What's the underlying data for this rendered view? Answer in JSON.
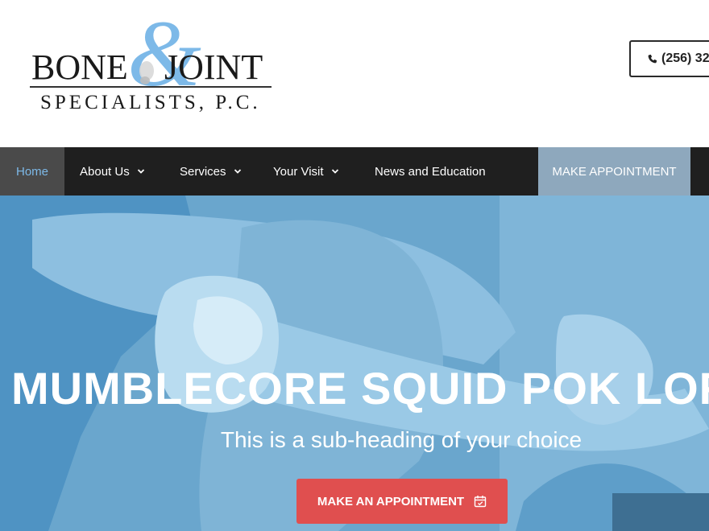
{
  "logo": {
    "word_left": "BONE",
    "word_right": "JOINT",
    "subtitle": "SPECIALISTS, P.C.",
    "ampersand_color": "#7db9e8"
  },
  "header": {
    "phone": "(256) 32",
    "phone_icon": "phone-icon"
  },
  "nav": {
    "items": [
      {
        "label": "Home",
        "active": true
      },
      {
        "label": "About Us",
        "has_dropdown": true
      },
      {
        "label": "Services",
        "has_dropdown": true
      },
      {
        "label": "Your Visit",
        "has_dropdown": true
      },
      {
        "label": "News and Education",
        "has_dropdown": false
      }
    ],
    "cta": "MAKE APPOINTMENT"
  },
  "hero": {
    "title": "MUMBLECORE SQUID POK LOR",
    "subheading": "This is a sub-heading of your choice",
    "button_label": "MAKE AN APPOINTMENT",
    "button_icon": "calendar-icon"
  },
  "colors": {
    "accent_blue": "#7db9e8",
    "nav_bg": "#1f1f1f",
    "cta_bg": "#8ea8bd",
    "button_red": "#e04f4f",
    "hero_tint": "#6aa6cd"
  }
}
